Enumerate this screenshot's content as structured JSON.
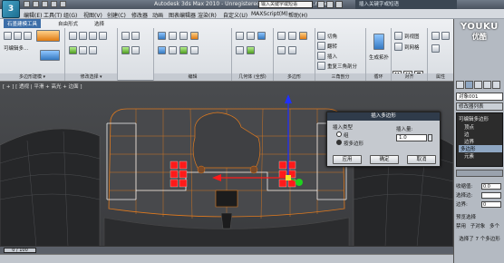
{
  "title_bar": {
    "title": "Autodesk 3ds Max  2010  - Unregistered Version   High_Poly1.max",
    "search_placeholder": "输入关键字或短语",
    "popup_title": "插入关键字或短语",
    "logo_text": "3"
  },
  "menu": [
    "编辑(E)",
    "工具(T)",
    "组(G)",
    "视图(V)",
    "创建(C)",
    "修改器",
    "动画",
    "图表编辑器",
    "渲染(R)",
    "自定义(U)",
    "MAXScript(M)",
    "帮助(H)"
  ],
  "ribbon": {
    "tabs": [
      "石墨建模工具",
      "自由形式",
      "选择"
    ],
    "panels": [
      {
        "label": "多边形建模 ▾",
        "item": "可编辑多..."
      },
      {
        "label": "修改选择 ▾"
      },
      {
        "label": "编辑"
      },
      {
        "label": "几何体 (全部)"
      },
      {
        "label": "多边形"
      },
      {
        "label": "循环"
      },
      {
        "label": "三角剖分"
      },
      {
        "label": "对齐"
      },
      {
        "label": "属性"
      }
    ],
    "edit_items": [
      "切角",
      "翻转",
      "插入",
      "重复三角剖分"
    ],
    "align_items": [
      "到视图",
      "到网格"
    ],
    "center_label": "生成拓扑",
    "axis_buttons": [
      "X",
      "Y",
      "Z"
    ]
  },
  "viewport": {
    "label": "[ + ] [ 透视 | 平滑 + 高光 + 边面 ]"
  },
  "dialog": {
    "title": "插入多边形",
    "group_type": "插入类型",
    "option_group": "组",
    "option_polygon": "按多边形",
    "amount_label": "插入量:",
    "amount_value": "1.0",
    "buttons": [
      "应用",
      "确定",
      "取消"
    ]
  },
  "side_panel": {
    "object_name": "对象001",
    "modifier_list": "修改器列表",
    "stack": [
      "可编辑多边形",
      "顶点",
      "边",
      "边界",
      "多边形",
      "元素"
    ],
    "selected_index": 4,
    "rows": [
      {
        "label": "收缩值:",
        "value": "0.0"
      },
      {
        "label": "选择边:",
        "value": ""
      },
      {
        "label": "边界:",
        "value": "0"
      }
    ],
    "preview_label": "预览选择",
    "preview_options": [
      "禁用",
      "子对象",
      "多个"
    ],
    "status": "选择了 7 个多边形"
  },
  "timeline": {
    "position": "0 / 100"
  },
  "watermark": {
    "logo": "YOUKU",
    "sub": "优酷"
  },
  "colors": {
    "ribbon_active_tab": "#3c6ea8",
    "dialog_title": "#2f3b4a",
    "viewport_bg": "#444649",
    "wire_orange": "#e07a1e",
    "gizmo_red": "#ff1a1a",
    "gizmo_green": "#1fd11f",
    "gizmo_blue": "#2030ff"
  }
}
